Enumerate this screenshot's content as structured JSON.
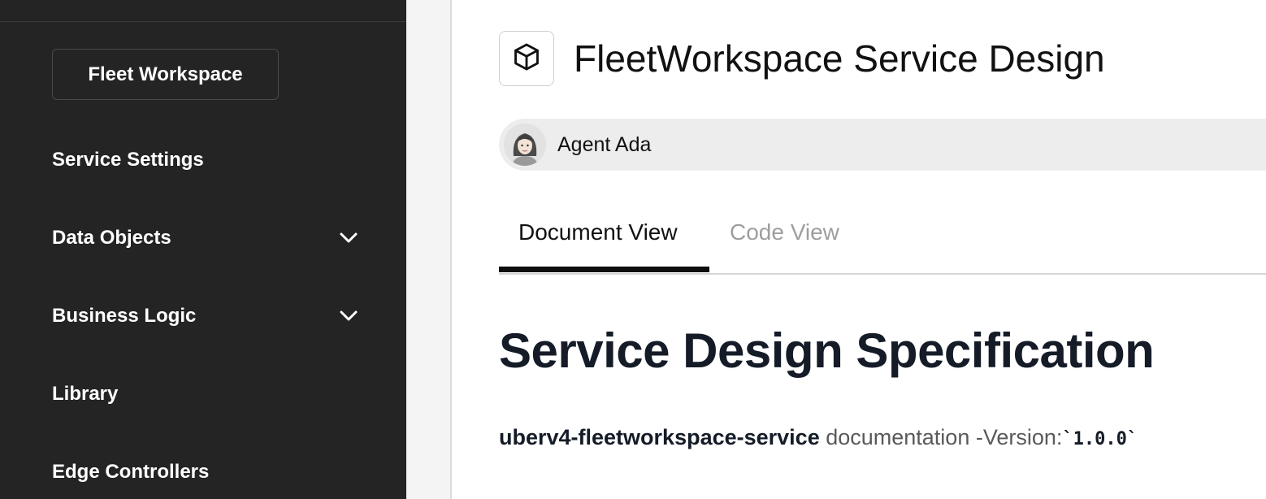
{
  "sidebar": {
    "workspace_button": "Fleet Workspace",
    "items": [
      {
        "label": "Service Settings",
        "has_chevron": false
      },
      {
        "label": "Data Objects",
        "has_chevron": true
      },
      {
        "label": "Business Logic",
        "has_chevron": true
      },
      {
        "label": "Library",
        "has_chevron": false
      },
      {
        "label": "Edge Controllers",
        "has_chevron": false
      }
    ],
    "chevron_icon": "chevron-down-icon"
  },
  "header": {
    "icon": "cube-icon",
    "title": "FleetWorkspace Service Design"
  },
  "agent": {
    "avatar_icon": "avatar",
    "name": "Agent Ada"
  },
  "tabs": [
    {
      "label": "Document View",
      "active": true
    },
    {
      "label": "Code View",
      "active": false
    }
  ],
  "document": {
    "heading": "Service Design Specification",
    "service_name": "uberv4-fleetworkspace-service",
    "middle_text": " documentation -Version:",
    "version": "`1.0.0`"
  },
  "colors": {
    "sidebar_bg": "#242424",
    "heading": "#151c28",
    "tab_inactive": "#9e9e9e",
    "agent_bar_bg": "#ededed"
  }
}
